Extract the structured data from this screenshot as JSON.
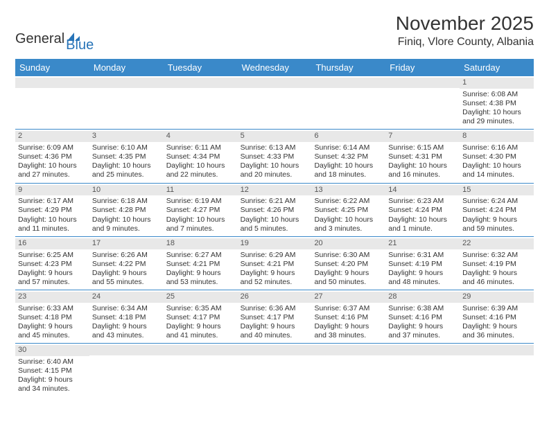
{
  "logo": {
    "text1": "General",
    "text2": "Blue"
  },
  "header": {
    "month_title": "November 2025",
    "location": "Finiq, Vlore County, Albania"
  },
  "weekdays": [
    "Sunday",
    "Monday",
    "Tuesday",
    "Wednesday",
    "Thursday",
    "Friday",
    "Saturday"
  ],
  "weeks": [
    [
      {
        "day": "",
        "sunrise": "",
        "sunset": "",
        "daylight": ""
      },
      {
        "day": "",
        "sunrise": "",
        "sunset": "",
        "daylight": ""
      },
      {
        "day": "",
        "sunrise": "",
        "sunset": "",
        "daylight": ""
      },
      {
        "day": "",
        "sunrise": "",
        "sunset": "",
        "daylight": ""
      },
      {
        "day": "",
        "sunrise": "",
        "sunset": "",
        "daylight": ""
      },
      {
        "day": "",
        "sunrise": "",
        "sunset": "",
        "daylight": ""
      },
      {
        "day": "1",
        "sunrise": "Sunrise: 6:08 AM",
        "sunset": "Sunset: 4:38 PM",
        "daylight": "Daylight: 10 hours and 29 minutes."
      }
    ],
    [
      {
        "day": "2",
        "sunrise": "Sunrise: 6:09 AM",
        "sunset": "Sunset: 4:36 PM",
        "daylight": "Daylight: 10 hours and 27 minutes."
      },
      {
        "day": "3",
        "sunrise": "Sunrise: 6:10 AM",
        "sunset": "Sunset: 4:35 PM",
        "daylight": "Daylight: 10 hours and 25 minutes."
      },
      {
        "day": "4",
        "sunrise": "Sunrise: 6:11 AM",
        "sunset": "Sunset: 4:34 PM",
        "daylight": "Daylight: 10 hours and 22 minutes."
      },
      {
        "day": "5",
        "sunrise": "Sunrise: 6:13 AM",
        "sunset": "Sunset: 4:33 PM",
        "daylight": "Daylight: 10 hours and 20 minutes."
      },
      {
        "day": "6",
        "sunrise": "Sunrise: 6:14 AM",
        "sunset": "Sunset: 4:32 PM",
        "daylight": "Daylight: 10 hours and 18 minutes."
      },
      {
        "day": "7",
        "sunrise": "Sunrise: 6:15 AM",
        "sunset": "Sunset: 4:31 PM",
        "daylight": "Daylight: 10 hours and 16 minutes."
      },
      {
        "day": "8",
        "sunrise": "Sunrise: 6:16 AM",
        "sunset": "Sunset: 4:30 PM",
        "daylight": "Daylight: 10 hours and 14 minutes."
      }
    ],
    [
      {
        "day": "9",
        "sunrise": "Sunrise: 6:17 AM",
        "sunset": "Sunset: 4:29 PM",
        "daylight": "Daylight: 10 hours and 11 minutes."
      },
      {
        "day": "10",
        "sunrise": "Sunrise: 6:18 AM",
        "sunset": "Sunset: 4:28 PM",
        "daylight": "Daylight: 10 hours and 9 minutes."
      },
      {
        "day": "11",
        "sunrise": "Sunrise: 6:19 AM",
        "sunset": "Sunset: 4:27 PM",
        "daylight": "Daylight: 10 hours and 7 minutes."
      },
      {
        "day": "12",
        "sunrise": "Sunrise: 6:21 AM",
        "sunset": "Sunset: 4:26 PM",
        "daylight": "Daylight: 10 hours and 5 minutes."
      },
      {
        "day": "13",
        "sunrise": "Sunrise: 6:22 AM",
        "sunset": "Sunset: 4:25 PM",
        "daylight": "Daylight: 10 hours and 3 minutes."
      },
      {
        "day": "14",
        "sunrise": "Sunrise: 6:23 AM",
        "sunset": "Sunset: 4:24 PM",
        "daylight": "Daylight: 10 hours and 1 minute."
      },
      {
        "day": "15",
        "sunrise": "Sunrise: 6:24 AM",
        "sunset": "Sunset: 4:24 PM",
        "daylight": "Daylight: 9 hours and 59 minutes."
      }
    ],
    [
      {
        "day": "16",
        "sunrise": "Sunrise: 6:25 AM",
        "sunset": "Sunset: 4:23 PM",
        "daylight": "Daylight: 9 hours and 57 minutes."
      },
      {
        "day": "17",
        "sunrise": "Sunrise: 6:26 AM",
        "sunset": "Sunset: 4:22 PM",
        "daylight": "Daylight: 9 hours and 55 minutes."
      },
      {
        "day": "18",
        "sunrise": "Sunrise: 6:27 AM",
        "sunset": "Sunset: 4:21 PM",
        "daylight": "Daylight: 9 hours and 53 minutes."
      },
      {
        "day": "19",
        "sunrise": "Sunrise: 6:29 AM",
        "sunset": "Sunset: 4:21 PM",
        "daylight": "Daylight: 9 hours and 52 minutes."
      },
      {
        "day": "20",
        "sunrise": "Sunrise: 6:30 AM",
        "sunset": "Sunset: 4:20 PM",
        "daylight": "Daylight: 9 hours and 50 minutes."
      },
      {
        "day": "21",
        "sunrise": "Sunrise: 6:31 AM",
        "sunset": "Sunset: 4:19 PM",
        "daylight": "Daylight: 9 hours and 48 minutes."
      },
      {
        "day": "22",
        "sunrise": "Sunrise: 6:32 AM",
        "sunset": "Sunset: 4:19 PM",
        "daylight": "Daylight: 9 hours and 46 minutes."
      }
    ],
    [
      {
        "day": "23",
        "sunrise": "Sunrise: 6:33 AM",
        "sunset": "Sunset: 4:18 PM",
        "daylight": "Daylight: 9 hours and 45 minutes."
      },
      {
        "day": "24",
        "sunrise": "Sunrise: 6:34 AM",
        "sunset": "Sunset: 4:18 PM",
        "daylight": "Daylight: 9 hours and 43 minutes."
      },
      {
        "day": "25",
        "sunrise": "Sunrise: 6:35 AM",
        "sunset": "Sunset: 4:17 PM",
        "daylight": "Daylight: 9 hours and 41 minutes."
      },
      {
        "day": "26",
        "sunrise": "Sunrise: 6:36 AM",
        "sunset": "Sunset: 4:17 PM",
        "daylight": "Daylight: 9 hours and 40 minutes."
      },
      {
        "day": "27",
        "sunrise": "Sunrise: 6:37 AM",
        "sunset": "Sunset: 4:16 PM",
        "daylight": "Daylight: 9 hours and 38 minutes."
      },
      {
        "day": "28",
        "sunrise": "Sunrise: 6:38 AM",
        "sunset": "Sunset: 4:16 PM",
        "daylight": "Daylight: 9 hours and 37 minutes."
      },
      {
        "day": "29",
        "sunrise": "Sunrise: 6:39 AM",
        "sunset": "Sunset: 4:16 PM",
        "daylight": "Daylight: 9 hours and 36 minutes."
      }
    ],
    [
      {
        "day": "30",
        "sunrise": "Sunrise: 6:40 AM",
        "sunset": "Sunset: 4:15 PM",
        "daylight": "Daylight: 9 hours and 34 minutes."
      },
      {
        "day": "",
        "sunrise": "",
        "sunset": "",
        "daylight": ""
      },
      {
        "day": "",
        "sunrise": "",
        "sunset": "",
        "daylight": ""
      },
      {
        "day": "",
        "sunrise": "",
        "sunset": "",
        "daylight": ""
      },
      {
        "day": "",
        "sunrise": "",
        "sunset": "",
        "daylight": ""
      },
      {
        "day": "",
        "sunrise": "",
        "sunset": "",
        "daylight": ""
      },
      {
        "day": "",
        "sunrise": "",
        "sunset": "",
        "daylight": ""
      }
    ]
  ]
}
